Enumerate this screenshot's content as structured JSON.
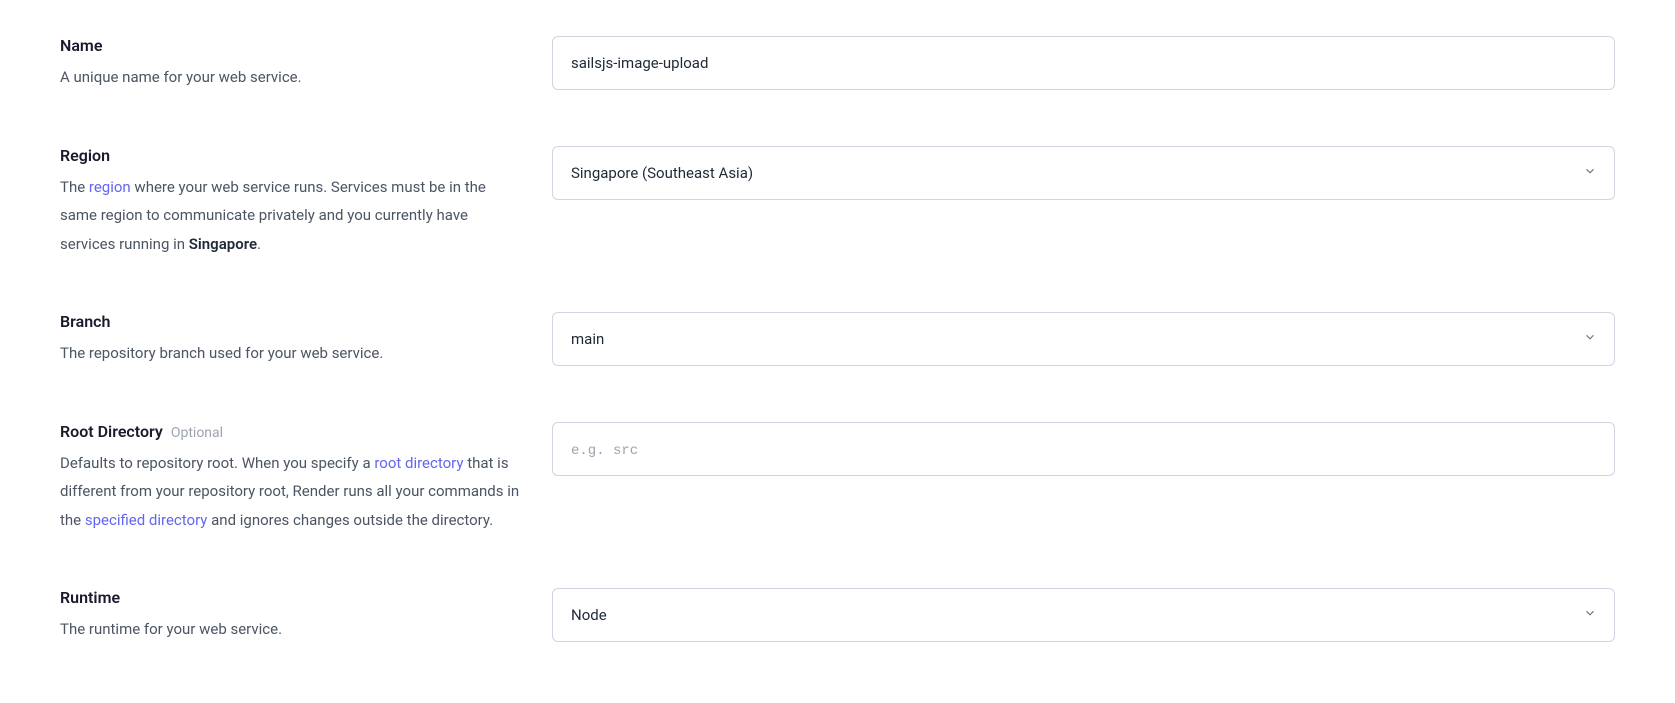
{
  "fields": {
    "name": {
      "label": "Name",
      "desc": "A unique name for your web service.",
      "value": "sailsjs-image-upload"
    },
    "region": {
      "label": "Region",
      "desc_prefix": "The ",
      "desc_link": "region",
      "desc_mid": " where your web service runs. Services must be in the same region to communicate privately and you currently have services running in ",
      "desc_strong": "Singapore",
      "desc_suffix": ".",
      "value": "Singapore (Southeast Asia)"
    },
    "branch": {
      "label": "Branch",
      "desc": "The repository branch used for your web service.",
      "value": "main"
    },
    "root_directory": {
      "label": "Root Directory",
      "optional": "Optional",
      "desc_prefix": "Defaults to repository root. When you specify a ",
      "desc_link1": "root directory",
      "desc_mid": " that is different from your repository root, Render runs all your commands in the ",
      "desc_link2": "specified directory",
      "desc_suffix": " and ignores changes outside the directory.",
      "placeholder": "e.g. src",
      "value": ""
    },
    "runtime": {
      "label": "Runtime",
      "desc": "The runtime for your web service.",
      "value": "Node"
    }
  }
}
